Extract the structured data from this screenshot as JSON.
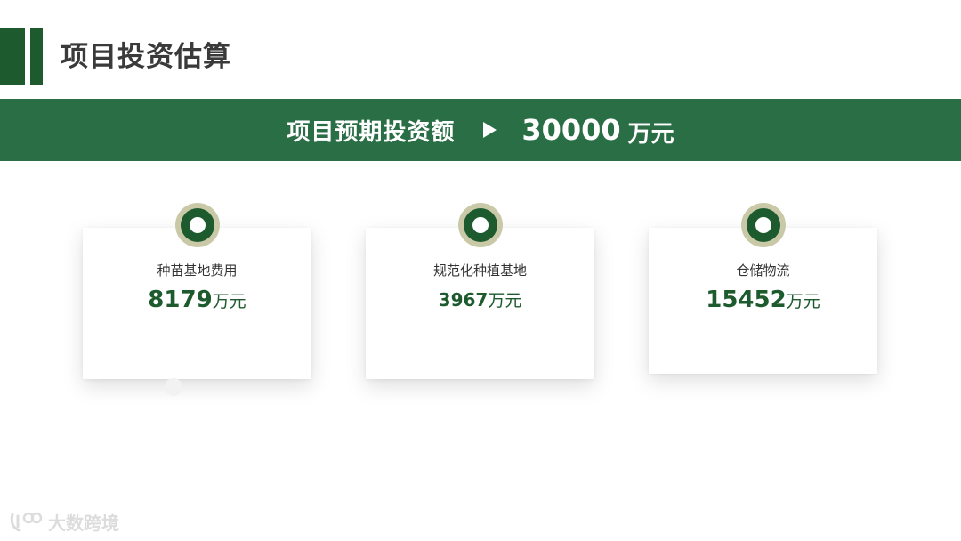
{
  "header": {
    "title": "项目投资估算"
  },
  "banner": {
    "label": "项目预期投资额",
    "amount": "30000",
    "unit": "万元"
  },
  "cards": [
    {
      "label": "种苗基地费用",
      "value": "8179",
      "unit": "万元"
    },
    {
      "label": "规范化种植基地",
      "value": "3967",
      "unit": "万元"
    },
    {
      "label": "仓储物流",
      "value": "15452",
      "unit": "万元"
    }
  ],
  "watermark": {
    "text": "大数跨境"
  },
  "colors": {
    "primary_green": "#1d5a2e",
    "banner_green": "#2a6e45",
    "marker_beige": "#c9c9a8"
  }
}
